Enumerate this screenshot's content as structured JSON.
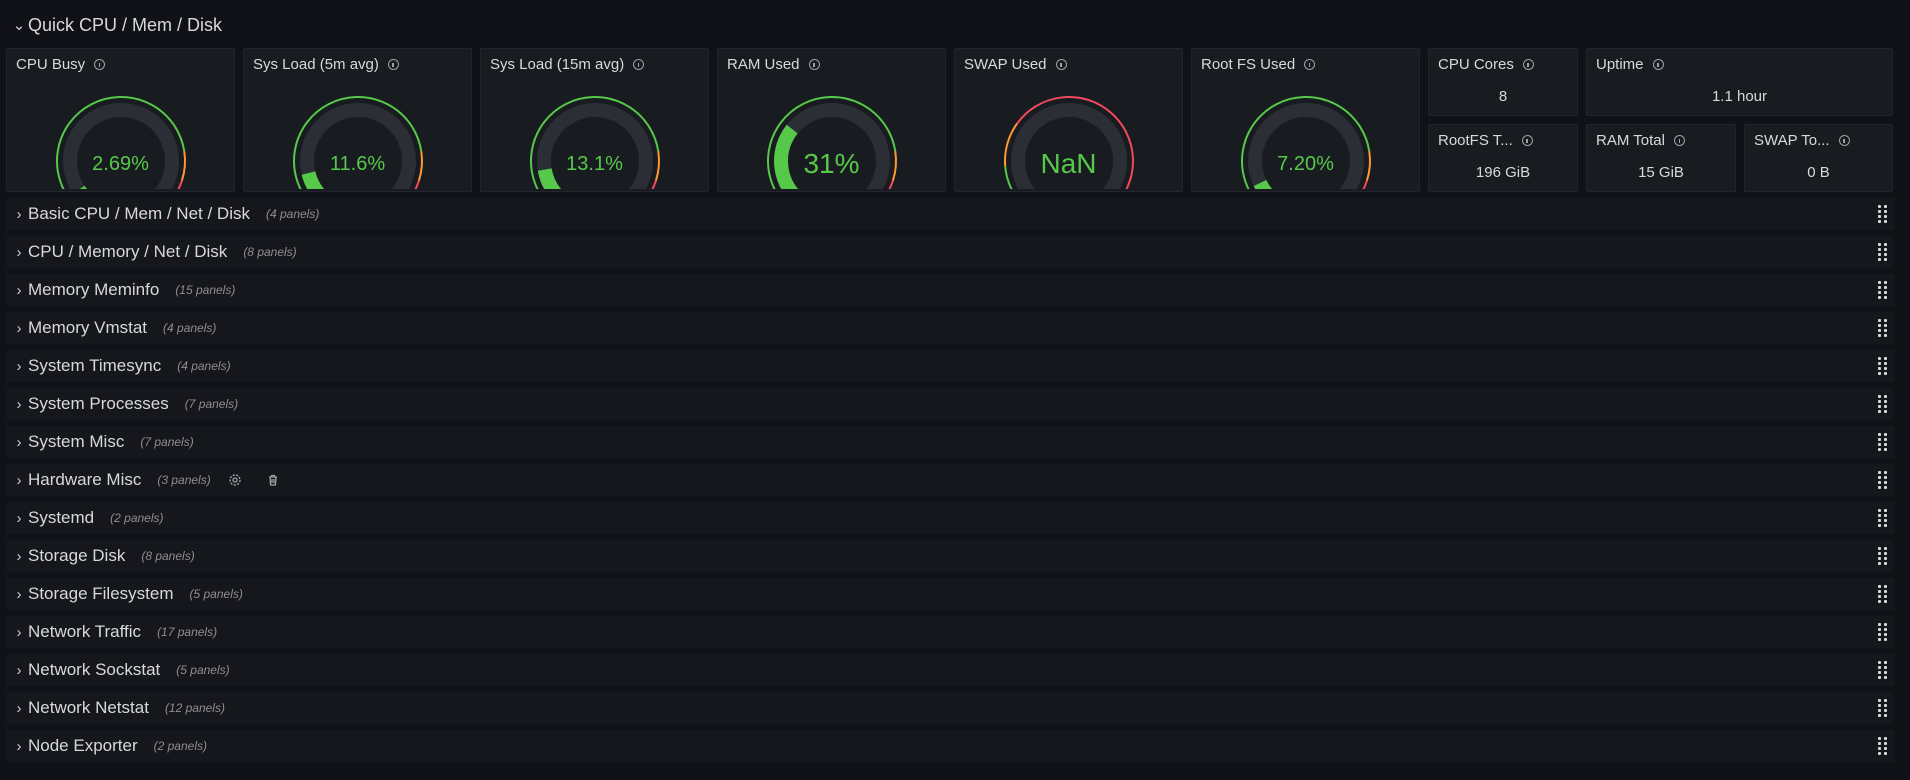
{
  "section": {
    "chevron": "chevron-down-icon",
    "title": "Quick CPU / Mem / Disk"
  },
  "gauges": [
    {
      "title": "CPU Busy",
      "value": "2.69%",
      "fraction": 0.027,
      "color": "#56c84a",
      "font": 20
    },
    {
      "title": "Sys Load (5m avg)",
      "value": "11.6%",
      "fraction": 0.116,
      "color": "#56c84a",
      "font": 20
    },
    {
      "title": "Sys Load (15m avg)",
      "value": "13.1%",
      "fraction": 0.131,
      "color": "#56c84a",
      "font": 20
    },
    {
      "title": "RAM Used",
      "value": "31%",
      "fraction": 0.31,
      "color": "#56c84a",
      "font": 28
    },
    {
      "title": "SWAP Used",
      "value": "NaN",
      "fraction": 0,
      "color": "#56c84a",
      "font": 28
    },
    {
      "title": "Root FS Used",
      "value": "7.20%",
      "fraction": 0.072,
      "color": "#56c84a",
      "font": 20
    }
  ],
  "stats": [
    {
      "title": "CPU Cores",
      "value": "8"
    },
    {
      "title": "Uptime",
      "value": "1.1 hour"
    },
    {
      "title": "RootFS T...",
      "value": "196 GiB"
    },
    {
      "title": "RAM Total",
      "value": "15 GiB"
    },
    {
      "title": "SWAP To...",
      "value": "0 B"
    }
  ],
  "colors": {
    "ok": "#56c84a",
    "warn": "#ff9830",
    "crit": "#f2495c",
    "track": "#2b2e34"
  },
  "rows": [
    {
      "title": "Basic CPU / Mem / Net / Disk",
      "count": "(4 panels)"
    },
    {
      "title": "CPU / Memory / Net / Disk",
      "count": "(8 panels)"
    },
    {
      "title": "Memory Meminfo",
      "count": "(15 panels)"
    },
    {
      "title": "Memory Vmstat",
      "count": "(4 panels)"
    },
    {
      "title": "System Timesync",
      "count": "(4 panels)"
    },
    {
      "title": "System Processes",
      "count": "(7 panels)"
    },
    {
      "title": "System Misc",
      "count": "(7 panels)"
    },
    {
      "title": "Hardware Misc",
      "count": "(3 panels)",
      "actions": [
        "gear-icon",
        "trash-icon"
      ]
    },
    {
      "title": "Systemd",
      "count": "(2 panels)"
    },
    {
      "title": "Storage Disk",
      "count": "(8 panels)"
    },
    {
      "title": "Storage Filesystem",
      "count": "(5 panels)"
    },
    {
      "title": "Network Traffic",
      "count": "(17 panels)"
    },
    {
      "title": "Network Sockstat",
      "count": "(5 panels)"
    },
    {
      "title": "Network Netstat",
      "count": "(12 panels)"
    },
    {
      "title": "Node Exporter",
      "count": "(2 panels)"
    }
  ]
}
